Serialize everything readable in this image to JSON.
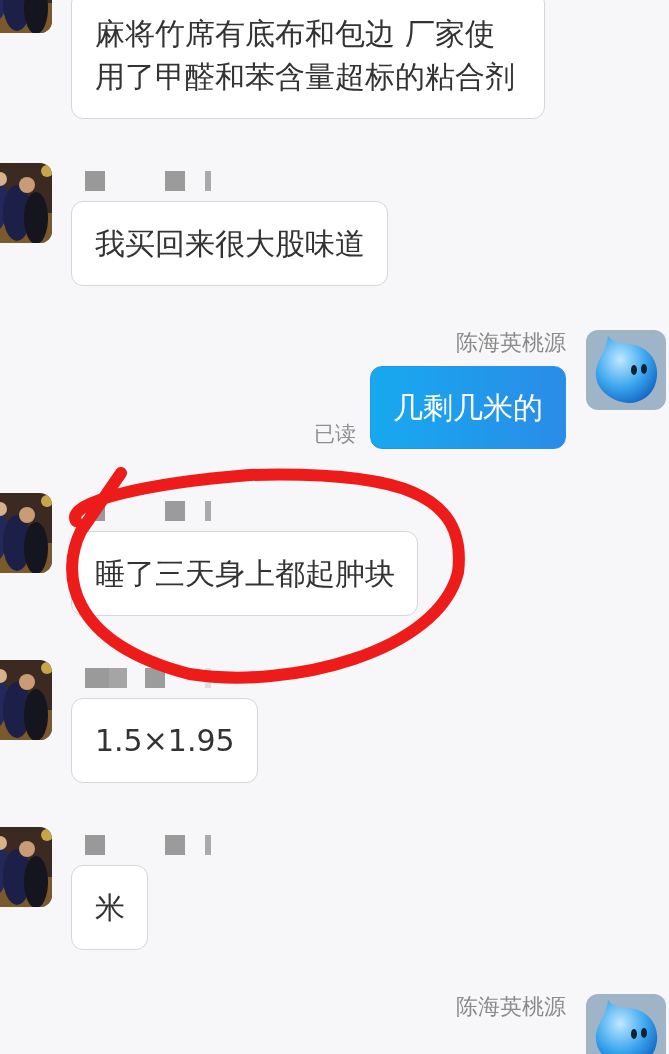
{
  "messages": [
    {
      "kind": "incoming",
      "text": "麻将竹席有底布和包边 厂家使用了甲醛和苯含量超标的粘合剂"
    },
    {
      "kind": "incoming",
      "name_obscured": true,
      "text": "我买回来很大股味道"
    },
    {
      "kind": "outgoing",
      "sender": "陈海英桃源",
      "text": "几剩几米的",
      "read_receipt": "已读"
    },
    {
      "kind": "incoming",
      "name_obscured": true,
      "text": "睡了三天身上都起肿块",
      "annotated": true
    },
    {
      "kind": "incoming",
      "name_obscured": true,
      "text": "1.5×1.95"
    },
    {
      "kind": "incoming",
      "name_obscured": true,
      "text": "米"
    },
    {
      "kind": "outgoing",
      "sender": "陈海英桃源"
    }
  ]
}
